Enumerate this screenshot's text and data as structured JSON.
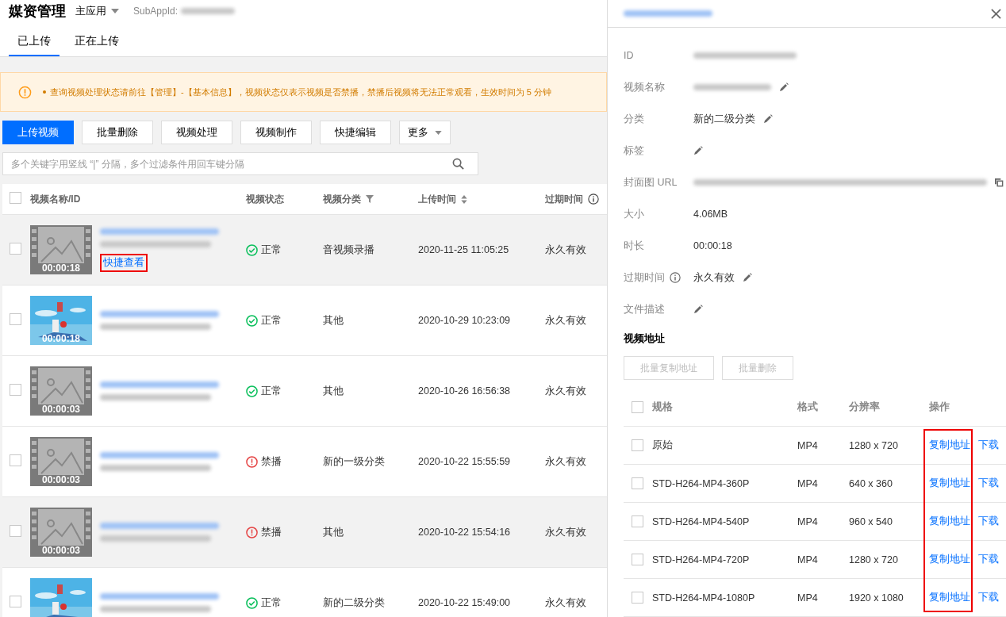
{
  "header": {
    "title": "媒资管理",
    "app_switch": "主应用",
    "subappid_label": "SubAppId:"
  },
  "tabs": [
    {
      "label": "已上传",
      "selected": true
    },
    {
      "label": "正在上传",
      "selected": false
    }
  ],
  "notice": "查询视频处理状态请前往【管理】-【基本信息】，视频状态仅表示视频是否禁播，禁播后视频将无法正常观看，生效时间为 5 分钟",
  "toolbar": [
    {
      "label": "上传视频",
      "kind": "primary"
    },
    {
      "label": "批量删除",
      "kind": "default"
    },
    {
      "label": "视频处理",
      "kind": "default"
    },
    {
      "label": "视频制作",
      "kind": "default"
    },
    {
      "label": "快捷编辑",
      "kind": "default"
    },
    {
      "label": "更多",
      "kind": "dropdown"
    }
  ],
  "search": {
    "placeholder": "多个关键字用竖线 “|” 分隔，多个过滤条件用回车键分隔"
  },
  "table": {
    "all_checked": false,
    "columns": [
      "视频名称/ID",
      "视频状态",
      "视频分类",
      "上传时间",
      "过期时间"
    ],
    "rows": [
      {
        "thumbnail": {
          "kind": "placeholder",
          "duration": "00:00:18"
        },
        "quick_view": "快捷查看",
        "quick_view_highlighted": true,
        "status": {
          "kind": "normal",
          "label": "正常"
        },
        "category": "音视频录播",
        "uploaded": "2020-11-25 11:05:25",
        "expiry": "永久有效",
        "shaded": true,
        "checked": false
      },
      {
        "thumbnail": {
          "kind": "picture",
          "duration": "00:00:18"
        },
        "status": {
          "kind": "normal",
          "label": "正常"
        },
        "category": "其他",
        "uploaded": "2020-10-29 10:23:09",
        "expiry": "永久有效",
        "shaded": false,
        "checked": false
      },
      {
        "thumbnail": {
          "kind": "placeholder",
          "duration": "00:00:03"
        },
        "status": {
          "kind": "normal",
          "label": "正常"
        },
        "category": "其他",
        "uploaded": "2020-10-26 16:56:38",
        "expiry": "永久有效",
        "shaded": false,
        "checked": false
      },
      {
        "thumbnail": {
          "kind": "placeholder",
          "duration": "00:00:03"
        },
        "status": {
          "kind": "banned",
          "label": "禁播"
        },
        "category": "新的一级分类",
        "uploaded": "2020-10-22 15:55:59",
        "expiry": "永久有效",
        "shaded": false,
        "checked": false
      },
      {
        "thumbnail": {
          "kind": "placeholder",
          "duration": "00:00:03"
        },
        "status": {
          "kind": "banned",
          "label": "禁播"
        },
        "category": "其他",
        "uploaded": "2020-10-22 15:54:16",
        "expiry": "永久有效",
        "shaded": true,
        "checked": false
      },
      {
        "status": {
          "kind": "normal",
          "label": "正常"
        },
        "category": "新的二级分类",
        "uploaded": "2020-10-22 15:49:00",
        "expiry": "永久有效",
        "shaded": false,
        "checked": false
      }
    ]
  },
  "drawer": {
    "fields": [
      {
        "label": "ID",
        "blurred": true
      },
      {
        "label": "视频名称",
        "blurred": true,
        "editable": true
      },
      {
        "label": "分类",
        "value": "新的二级分类",
        "editable": true
      },
      {
        "label": "标签",
        "editable": true
      },
      {
        "label": "封面图 URL",
        "blurred": true,
        "copyable": true
      },
      {
        "label": "大小",
        "value": "4.06MB"
      },
      {
        "label": "时长",
        "value": "00:00:18"
      },
      {
        "label": "过期时间",
        "info": true,
        "value": "永久有效",
        "editable": true
      },
      {
        "label": "文件描述",
        "editable": true
      }
    ],
    "address_title": "视频地址",
    "address_buttons": [
      {
        "label": "批量复制地址",
        "disabled": true
      },
      {
        "label": "批量删除",
        "disabled": true
      }
    ],
    "all_checked": false,
    "address_columns": [
      "规格",
      "格式",
      "分辨率",
      "操作"
    ],
    "actions_highlighted": true,
    "addresses": [
      {
        "spec": "原始",
        "format": "MP4",
        "resolution": "1280 x 720",
        "copy": "复制地址",
        "download": "下载",
        "checked": false
      },
      {
        "spec": "STD-H264-MP4-360P",
        "format": "MP4",
        "resolution": "640 x 360",
        "copy": "复制地址",
        "download": "下载",
        "checked": false
      },
      {
        "spec": "STD-H264-MP4-540P",
        "format": "MP4",
        "resolution": "960 x 540",
        "copy": "复制地址",
        "download": "下载",
        "checked": false
      },
      {
        "spec": "STD-H264-MP4-720P",
        "format": "MP4",
        "resolution": "1280 x 720",
        "copy": "复制地址",
        "download": "下载",
        "checked": false
      },
      {
        "spec": "STD-H264-MP4-1080P",
        "format": "MP4",
        "resolution": "1920 x 1080",
        "copy": "复制地址",
        "download": "下载",
        "checked": false
      }
    ]
  }
}
